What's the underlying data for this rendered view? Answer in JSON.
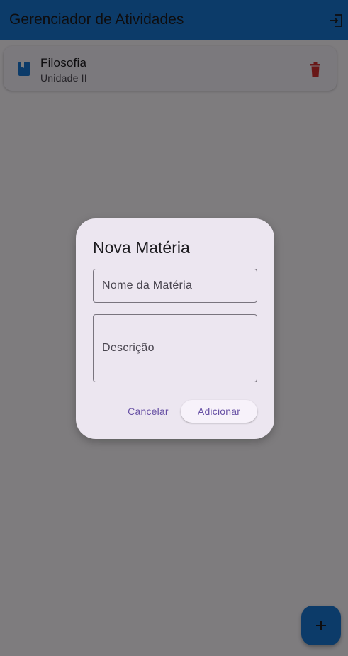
{
  "appbar": {
    "title": "Gerenciador de Atividades",
    "action_icon": "logout-icon",
    "color": "#1976d2"
  },
  "subjects": [
    {
      "title": "Filosofia",
      "subtitle": "Unidade II",
      "icon": "book-icon",
      "action_icon": "delete-icon"
    }
  ],
  "dialog": {
    "title": "Nova Matéria",
    "name_label": "Nome da Matéria",
    "description_label": "Descrição",
    "cancel_label": "Cancelar",
    "add_label": "Adicionar"
  },
  "fab": {
    "icon": "add-icon"
  },
  "colors": {
    "primary": "#1976d2",
    "accent": "#6750a4",
    "danger": "#d32f2f",
    "dialog_bg": "#ece6f0"
  }
}
